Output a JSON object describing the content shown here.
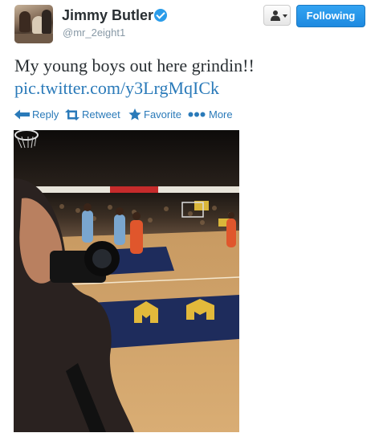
{
  "user": {
    "name": "Jimmy Butler",
    "handle": "@mr_2eight1",
    "verified": true
  },
  "buttons": {
    "follow_label": "Following"
  },
  "tweet": {
    "text": "My young boys out here grindin!!",
    "link": "pic.twitter.com/y3LrgMqICk"
  },
  "actions": [
    {
      "label": "Reply",
      "icon": "reply-icon"
    },
    {
      "label": "Retweet",
      "icon": "retweet-icon"
    },
    {
      "label": "Favorite",
      "icon": "star-icon"
    },
    {
      "label": "More",
      "icon": "more-dots-icon"
    }
  ],
  "colors": {
    "link": "#2a7ab9",
    "follow_button": "#1e8ae0",
    "verified": "#2b9ce9",
    "handle": "#8899a6"
  }
}
